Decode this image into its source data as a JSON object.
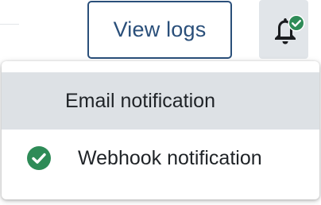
{
  "toolbar": {
    "view_logs_label": "View logs",
    "notifications_icon": "bell-icon",
    "notifications_badge_icon": "check-badge-icon"
  },
  "menu": {
    "items": [
      {
        "label": "Email notification",
        "selected": true,
        "checked": false
      },
      {
        "label": "Webhook notification",
        "selected": false,
        "checked": true,
        "icon": "check-circle-icon"
      }
    ]
  },
  "colors": {
    "accent": "#2a4f7a",
    "success": "#2e8b57",
    "selected_bg": "#dde1e5",
    "bell_bg": "#e1e5e9"
  }
}
